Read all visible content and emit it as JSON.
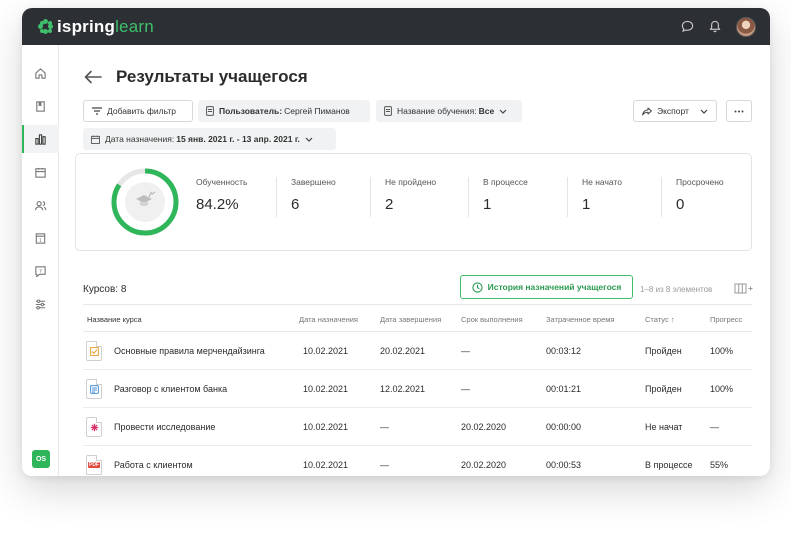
{
  "app": {
    "logo_part1": "ispring",
    "logo_part2": "learn",
    "user_initials": "OS"
  },
  "page": {
    "title": "Результаты учащегося"
  },
  "filters": {
    "add_filter": "Добавить фильтр",
    "user_label": "Пользователь:",
    "user_value": "Сергей Пиманов",
    "training_label": "Название обучения:",
    "training_value": "Все",
    "date_label": "Дата назначения:",
    "date_value": "15 янв. 2021 г. - 13 апр. 2021 г.",
    "export": "Экспорт"
  },
  "stats": {
    "progress_fraction": 0.842,
    "items": [
      {
        "label": "Обученность",
        "value": "84.2%"
      },
      {
        "label": "Завершено",
        "value": "6"
      },
      {
        "label": "Не пройдено",
        "value": "2"
      },
      {
        "label": "В процессе",
        "value": "1"
      },
      {
        "label": "Не начато",
        "value": "1"
      },
      {
        "label": "Просрочено",
        "value": "0"
      }
    ]
  },
  "courses": {
    "count_label": "Курсов: 8",
    "history_button": "История назначений учащегося",
    "pager": "1–8 из 8 элементов",
    "columns": [
      "Название курса",
      "Дата назначения",
      "Дата завершения",
      "Срок выполнения",
      "Затраченное время",
      "Статус ↑",
      "Прогресс"
    ],
    "rows": [
      {
        "icon": "quiz-icon",
        "name": "Основные правила мерчендайзинга",
        "assigned": "10.02.2021",
        "completed": "20.02.2021",
        "due": "—",
        "time": "00:03:12",
        "status": "Пройден",
        "progress": "100%"
      },
      {
        "icon": "dialog-icon",
        "name": "Разговор с клиентом банка",
        "assigned": "10.02.2021",
        "completed": "12.02.2021",
        "due": "—",
        "time": "00:01:21",
        "status": "Пройден",
        "progress": "100%"
      },
      {
        "icon": "survey-icon",
        "name": "Провести  исследование",
        "assigned": "10.02.2021",
        "completed": "—",
        "due": "20.02.2020",
        "time": "00:00:00",
        "status": "Не начат",
        "progress": "—"
      },
      {
        "icon": "pdf-icon",
        "name": "Работа с клиентом",
        "assigned": "10.02.2021",
        "completed": "—",
        "due": "20.02.2020",
        "time": "00:00:53",
        "status": "В процессе",
        "progress": "55%"
      }
    ]
  },
  "colors": {
    "accent": "#2fb55a",
    "topbar": "#2c2f34",
    "pdf": "#e0493b",
    "quiz": "#e8a23a",
    "dialog": "#4a90d9",
    "survey": "#d6336c"
  }
}
